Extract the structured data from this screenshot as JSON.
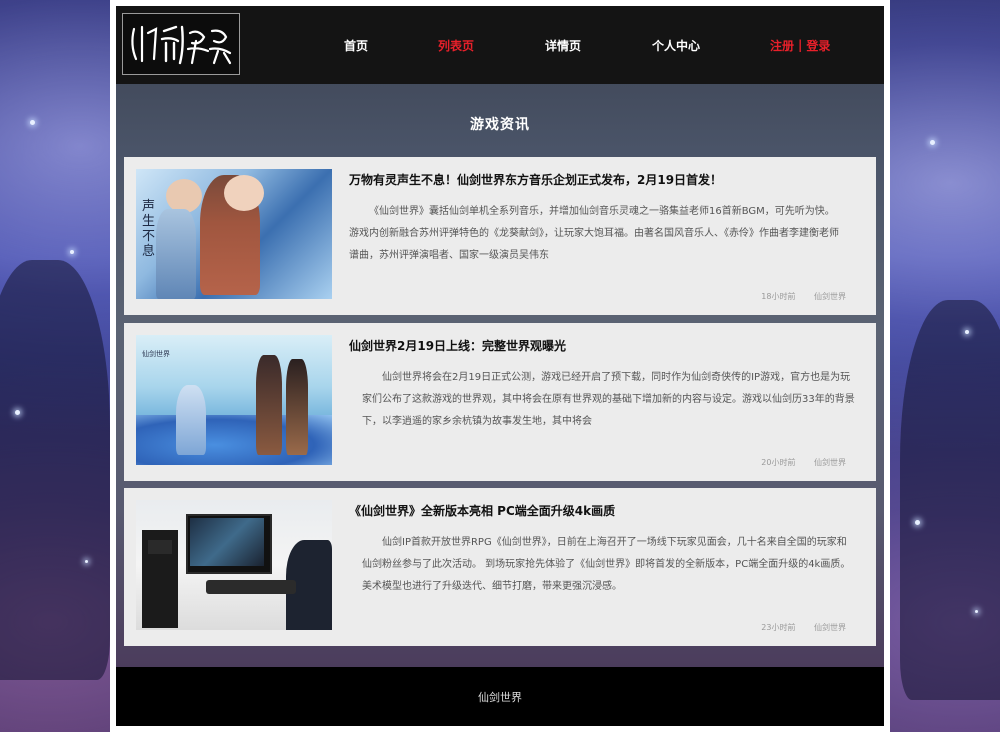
{
  "header": {
    "logo_text": "仙剑世界",
    "nav": [
      "首页",
      "列表页",
      "详情页",
      "个人中心"
    ],
    "register": "注册",
    "separator": "|",
    "login": "登录"
  },
  "page_title": "游戏资讯",
  "articles": [
    {
      "title": "万物有灵声生不息！仙剑世界东方音乐企划正式发布，2月19日首发！",
      "body": "《仙剑世界》囊括仙剑单机全系列音乐，并增加仙剑音乐灵魂之一骆集益老师16首新BGM，可先听为快。        游戏内创新融合苏州评弹特色的《龙葵献剑》，让玩家大饱耳福。由著名国风音乐人、《赤伶》作曲者李建衡老师谱曲，苏州评弹演唱者、国家一级演员吴伟东",
      "time": "18小时前",
      "source": "仙剑世界",
      "thumb_text": "声生不息"
    },
    {
      "title": "仙剑世界2月19日上线：完整世界观曝光",
      "body": "仙剑世界将会在2月19日正式公测，游戏已经开启了预下载，同时作为仙剑奇侠传的IP游戏，官方也是为玩家们公布了这款游戏的世界观，其中将会在原有世界观的基础下增加新的内容与设定。游戏以仙剑历33年的背景下，以李逍遥的家乡余杭镇为故事发生地，其中将会",
      "time": "20小时前",
      "source": "仙剑世界",
      "thumb_text": "仙剑世界"
    },
    {
      "title": "《仙剑世界》全新版本亮相 PC端全面升级4k画质",
      "body": "仙剑IP首款开放世界RPG《仙剑世界》，日前在上海召开了一场线下玩家见面会，几十名来自全国的玩家和仙剑粉丝参与了此次活动。 到场玩家抢先体验了《仙剑世界》即将首发的全新版本，PC端全面升级的4k画质。美术模型也进行了升级迭代、细节打磨，带来更强沉浸感。",
      "time": "23小时前",
      "source": "仙剑世界",
      "thumb_text": ""
    }
  ],
  "footer": "仙剑世界"
}
